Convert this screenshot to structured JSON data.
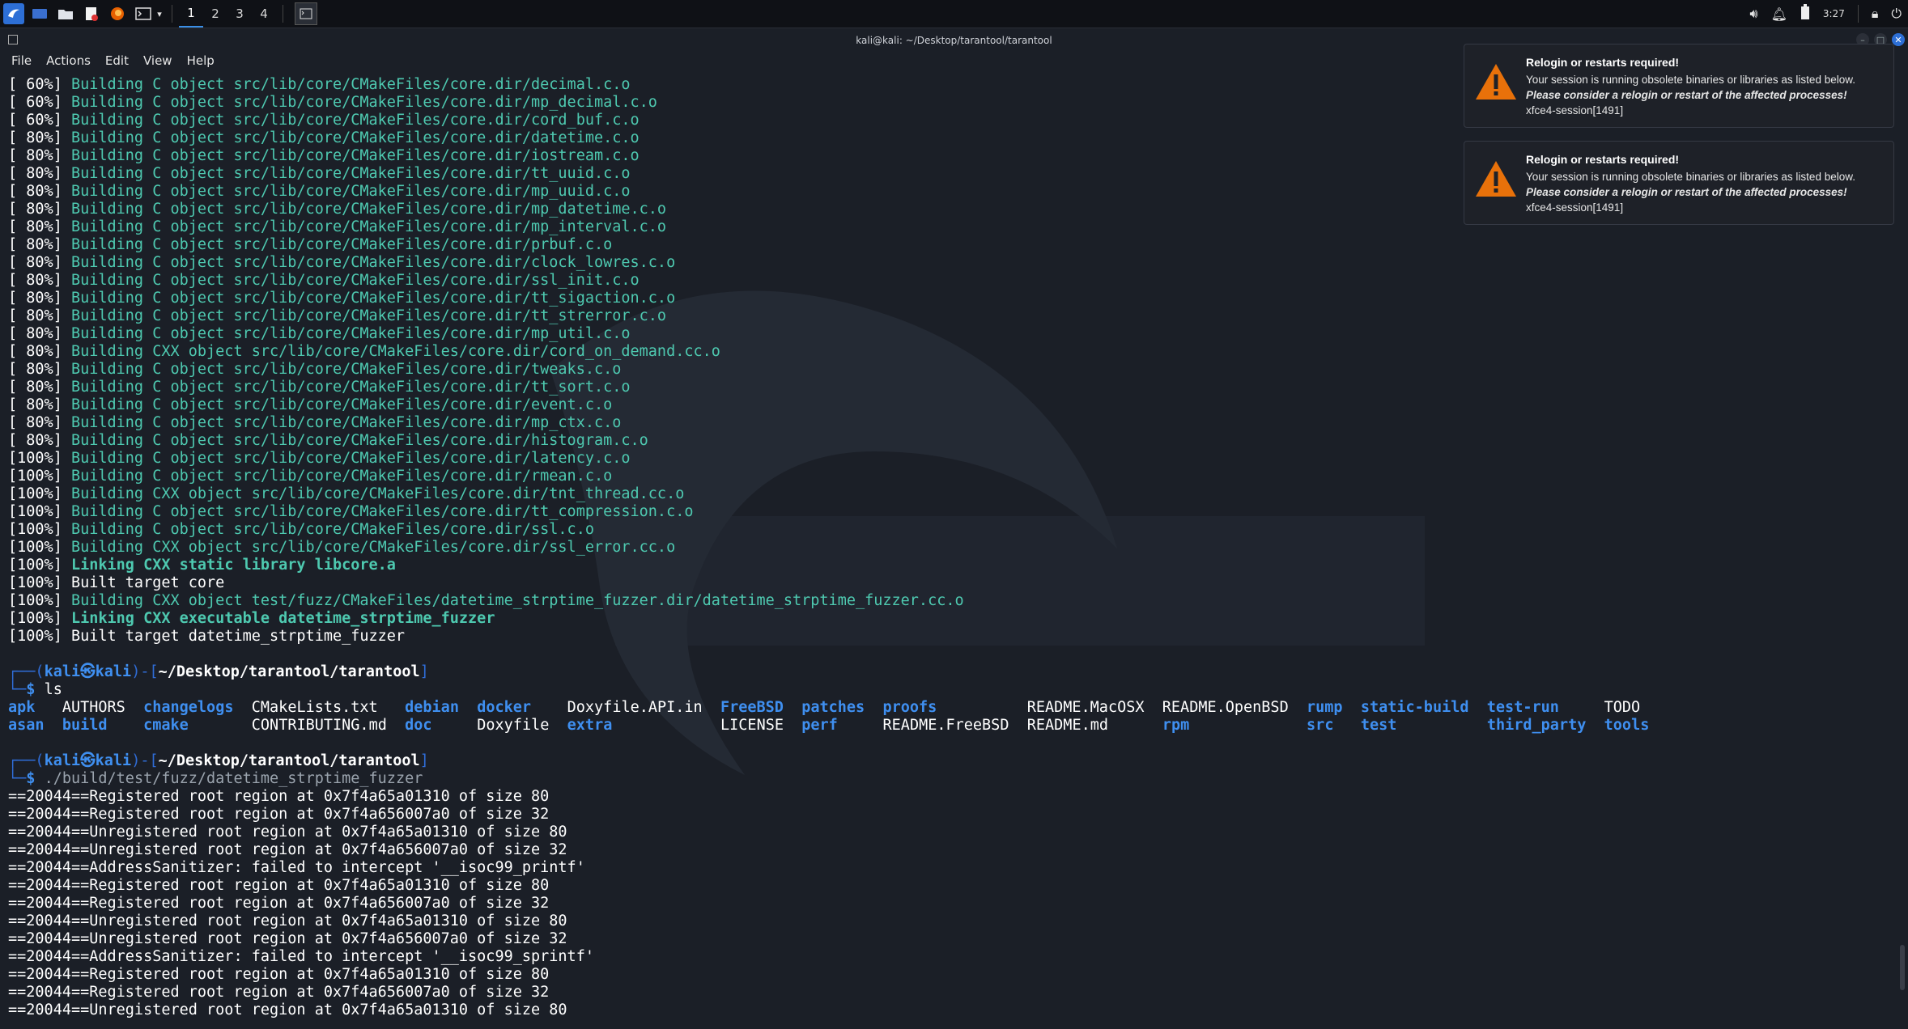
{
  "panel": {
    "workspaces": [
      "1",
      "2",
      "3",
      "4"
    ],
    "clock": "3:27"
  },
  "window": {
    "title": "kali@kali: ~/Desktop/tarantool/tarantool",
    "menu": [
      "File",
      "Actions",
      "Edit",
      "View",
      "Help"
    ]
  },
  "build": [
    {
      "pct": "[ 60%]",
      "kind": "b",
      "text": "Building C object src/lib/core/CMakeFiles/core.dir/decimal.c.o"
    },
    {
      "pct": "[ 60%]",
      "kind": "b",
      "text": "Building C object src/lib/core/CMakeFiles/core.dir/mp_decimal.c.o"
    },
    {
      "pct": "[ 60%]",
      "kind": "b",
      "text": "Building C object src/lib/core/CMakeFiles/core.dir/cord_buf.c.o"
    },
    {
      "pct": "[ 80%]",
      "kind": "b",
      "text": "Building C object src/lib/core/CMakeFiles/core.dir/datetime.c.o"
    },
    {
      "pct": "[ 80%]",
      "kind": "b",
      "text": "Building C object src/lib/core/CMakeFiles/core.dir/iostream.c.o"
    },
    {
      "pct": "[ 80%]",
      "kind": "b",
      "text": "Building C object src/lib/core/CMakeFiles/core.dir/tt_uuid.c.o"
    },
    {
      "pct": "[ 80%]",
      "kind": "b",
      "text": "Building C object src/lib/core/CMakeFiles/core.dir/mp_uuid.c.o"
    },
    {
      "pct": "[ 80%]",
      "kind": "b",
      "text": "Building C object src/lib/core/CMakeFiles/core.dir/mp_datetime.c.o"
    },
    {
      "pct": "[ 80%]",
      "kind": "b",
      "text": "Building C object src/lib/core/CMakeFiles/core.dir/mp_interval.c.o"
    },
    {
      "pct": "[ 80%]",
      "kind": "b",
      "text": "Building C object src/lib/core/CMakeFiles/core.dir/prbuf.c.o"
    },
    {
      "pct": "[ 80%]",
      "kind": "b",
      "text": "Building C object src/lib/core/CMakeFiles/core.dir/clock_lowres.c.o"
    },
    {
      "pct": "[ 80%]",
      "kind": "b",
      "text": "Building C object src/lib/core/CMakeFiles/core.dir/ssl_init.c.o"
    },
    {
      "pct": "[ 80%]",
      "kind": "b",
      "text": "Building C object src/lib/core/CMakeFiles/core.dir/tt_sigaction.c.o"
    },
    {
      "pct": "[ 80%]",
      "kind": "b",
      "text": "Building C object src/lib/core/CMakeFiles/core.dir/tt_strerror.c.o"
    },
    {
      "pct": "[ 80%]",
      "kind": "b",
      "text": "Building C object src/lib/core/CMakeFiles/core.dir/mp_util.c.o"
    },
    {
      "pct": "[ 80%]",
      "kind": "b",
      "text": "Building CXX object src/lib/core/CMakeFiles/core.dir/cord_on_demand.cc.o"
    },
    {
      "pct": "[ 80%]",
      "kind": "b",
      "text": "Building C object src/lib/core/CMakeFiles/core.dir/tweaks.c.o"
    },
    {
      "pct": "[ 80%]",
      "kind": "b",
      "text": "Building C object src/lib/core/CMakeFiles/core.dir/tt_sort.c.o"
    },
    {
      "pct": "[ 80%]",
      "kind": "b",
      "text": "Building C object src/lib/core/CMakeFiles/core.dir/event.c.o"
    },
    {
      "pct": "[ 80%]",
      "kind": "b",
      "text": "Building C object src/lib/core/CMakeFiles/core.dir/mp_ctx.c.o"
    },
    {
      "pct": "[ 80%]",
      "kind": "b",
      "text": "Building C object src/lib/core/CMakeFiles/core.dir/histogram.c.o"
    },
    {
      "pct": "[100%]",
      "kind": "b",
      "text": "Building C object src/lib/core/CMakeFiles/core.dir/latency.c.o"
    },
    {
      "pct": "[100%]",
      "kind": "b",
      "text": "Building C object src/lib/core/CMakeFiles/core.dir/rmean.c.o"
    },
    {
      "pct": "[100%]",
      "kind": "b",
      "text": "Building CXX object src/lib/core/CMakeFiles/core.dir/tnt_thread.cc.o"
    },
    {
      "pct": "[100%]",
      "kind": "b",
      "text": "Building C object src/lib/core/CMakeFiles/core.dir/tt_compression.c.o"
    },
    {
      "pct": "[100%]",
      "kind": "b",
      "text": "Building C object src/lib/core/CMakeFiles/core.dir/ssl.c.o"
    },
    {
      "pct": "[100%]",
      "kind": "b",
      "text": "Building CXX object src/lib/core/CMakeFiles/core.dir/ssl_error.cc.o"
    },
    {
      "pct": "[100%]",
      "kind": "l",
      "text": "Linking CXX static library libcore.a"
    },
    {
      "pct": "[100%]",
      "kind": "t",
      "text": "Built target core"
    },
    {
      "pct": "[100%]",
      "kind": "b",
      "text": "Building CXX object test/fuzz/CMakeFiles/datetime_strptime_fuzzer.dir/datetime_strptime_fuzzer.cc.o"
    },
    {
      "pct": "[100%]",
      "kind": "l",
      "text": "Linking CXX executable datetime_strptime_fuzzer"
    },
    {
      "pct": "[100%]",
      "kind": "t",
      "text": "Built target datetime_strptime_fuzzer"
    }
  ],
  "prompt": {
    "user": "kali",
    "host": "kali",
    "at": "㉿",
    "path": "~/Desktop/tarantool/tarantool",
    "cmd1": "ls",
    "cmd2": "./build/test/fuzz/datetime_strptime_fuzzer"
  },
  "ls_rows": [
    [
      {
        "t": "apk",
        "d": true,
        "col": 0
      },
      {
        "t": "AUTHORS",
        "d": false,
        "col": 6
      },
      {
        "t": "changelogs",
        "d": true,
        "col": 15
      },
      {
        "t": "CMakeLists.txt",
        "d": false,
        "col": 27
      },
      {
        "t": "debian",
        "d": true,
        "col": 44
      },
      {
        "t": "docker",
        "d": true,
        "col": 52
      },
      {
        "t": "Doxyfile.API.in",
        "d": false,
        "col": 62
      },
      {
        "t": "FreeBSD",
        "d": true,
        "col": 79
      },
      {
        "t": "patches",
        "d": true,
        "col": 88
      },
      {
        "t": "proofs",
        "d": true,
        "col": 97
      },
      {
        "t": "README.MacOSX",
        "d": false,
        "col": 113
      },
      {
        "t": "README.OpenBSD",
        "d": false,
        "col": 128
      },
      {
        "t": "rump",
        "d": true,
        "col": 144
      },
      {
        "t": "static-build",
        "d": true,
        "col": 150
      },
      {
        "t": "test-run",
        "d": true,
        "col": 164
      },
      {
        "t": "TODO",
        "d": false,
        "col": 177
      }
    ],
    [
      {
        "t": "asan",
        "d": true,
        "col": 0
      },
      {
        "t": "build",
        "d": true,
        "col": 6
      },
      {
        "t": "cmake",
        "d": true,
        "col": 15
      },
      {
        "t": "CONTRIBUTING.md",
        "d": false,
        "col": 27
      },
      {
        "t": "doc",
        "d": true,
        "col": 44
      },
      {
        "t": "Doxyfile",
        "d": false,
        "col": 52
      },
      {
        "t": "extra",
        "d": true,
        "col": 62
      },
      {
        "t": "LICENSE",
        "d": false,
        "col": 79
      },
      {
        "t": "perf",
        "d": true,
        "col": 88
      },
      {
        "t": "README.FreeBSD",
        "d": false,
        "col": 97
      },
      {
        "t": "README.md",
        "d": false,
        "col": 113
      },
      {
        "t": "rpm",
        "d": true,
        "col": 128
      },
      {
        "t": "src",
        "d": true,
        "col": 144
      },
      {
        "t": "test",
        "d": true,
        "col": 150
      },
      {
        "t": "third_party",
        "d": true,
        "col": 164
      },
      {
        "t": "tools",
        "d": true,
        "col": 177
      }
    ]
  ],
  "asan": [
    "==20044==Registered root region at 0x7f4a65a01310 of size 80",
    "==20044==Registered root region at 0x7f4a656007a0 of size 32",
    "==20044==Unregistered root region at 0x7f4a65a01310 of size 80",
    "==20044==Unregistered root region at 0x7f4a656007a0 of size 32",
    "==20044==AddressSanitizer: failed to intercept '__isoc99_printf'",
    "==20044==Registered root region at 0x7f4a65a01310 of size 80",
    "==20044==Registered root region at 0x7f4a656007a0 of size 32",
    "==20044==Unregistered root region at 0x7f4a65a01310 of size 80",
    "==20044==Unregistered root region at 0x7f4a656007a0 of size 32",
    "==20044==AddressSanitizer: failed to intercept '__isoc99_sprintf'",
    "==20044==Registered root region at 0x7f4a65a01310 of size 80",
    "==20044==Registered root region at 0x7f4a656007a0 of size 32",
    "==20044==Unregistered root region at 0x7f4a65a01310 of size 80"
  ],
  "notifications": [
    {
      "title": "Relogin or restarts required!",
      "line1": "Your session is running obsolete binaries or libraries as listed below.",
      "line2": "Please consider a relogin or restart of the affected processes!",
      "line3": "xfce4-session[1491]"
    },
    {
      "title": "Relogin or restarts required!",
      "line1": "Your session is running obsolete binaries or libraries as listed below.",
      "line2": "Please consider a relogin or restart of the affected processes!",
      "line3": "xfce4-session[1491]"
    }
  ],
  "colors": {
    "accent": "#3a8ee6",
    "build_text": "#4ec9b0",
    "directory": "#3f8ff0",
    "warning": "#e8710a"
  }
}
